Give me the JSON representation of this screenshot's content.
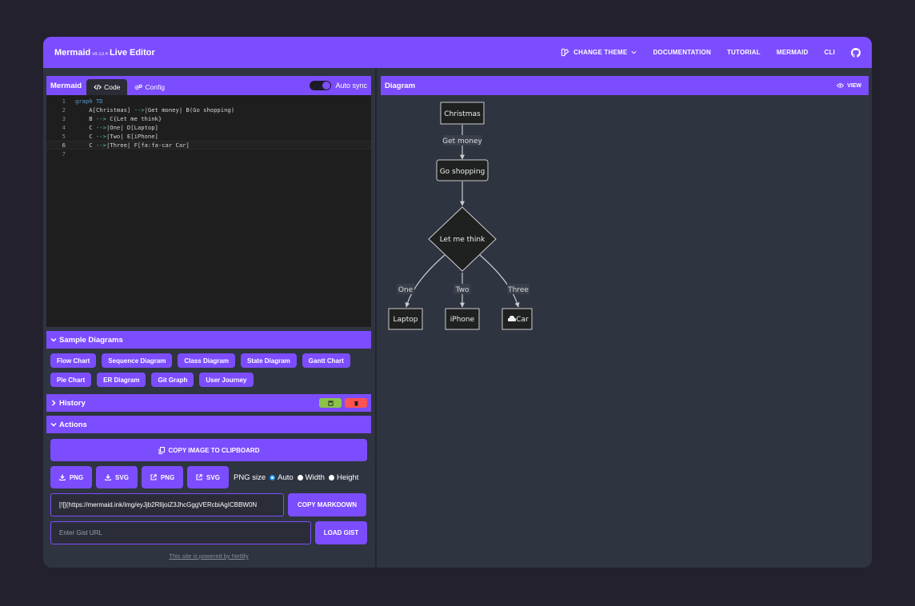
{
  "topbar": {
    "brand_name": "Mermaid",
    "brand_version": "v8.13.4",
    "brand_suffix": "Live Editor",
    "nav": [
      {
        "label": "CHANGE THEME",
        "icon": "palette-icon"
      },
      {
        "label": "DOCUMENTATION"
      },
      {
        "label": "TUTORIAL"
      },
      {
        "label": "MERMAID"
      },
      {
        "label": "CLI"
      }
    ],
    "github_icon": "github-icon"
  },
  "editor": {
    "title": "Mermaid",
    "tab_code": "Code",
    "tab_config": "Config",
    "auto_sync_label": "Auto sync",
    "auto_sync_on": true,
    "lines": [
      {
        "n": "1",
        "text": "graph TD"
      },
      {
        "n": "2",
        "text": "    A[Christmas] -->|Get money| B(Go shopping)"
      },
      {
        "n": "3",
        "text": "    B --> C{Let me think}"
      },
      {
        "n": "4",
        "text": "    C -->|One| D[Laptop]"
      },
      {
        "n": "5",
        "text": "    C -->|Two| E[iPhone]"
      },
      {
        "n": "6",
        "text": "    C -->|Three| F[fa:fa-car Car]"
      },
      {
        "n": "7",
        "text": ""
      }
    ],
    "current_line": 6
  },
  "samples": {
    "title": "Sample Diagrams",
    "buttons": [
      "Flow Chart",
      "Sequence Diagram",
      "Class Diagram",
      "State Diagram",
      "Gantt Chart",
      "Pie Chart",
      "ER Diagram",
      "Git Graph",
      "User Journey"
    ]
  },
  "history": {
    "title": "History",
    "save_color": "#8bc34a",
    "delete_color": "#ff5252"
  },
  "actions": {
    "title": "Actions",
    "copy_image_label": "COPY IMAGE TO CLIPBOARD",
    "export_buttons": [
      {
        "label": "PNG",
        "icon": "download-icon"
      },
      {
        "label": "SVG",
        "icon": "download-icon"
      },
      {
        "label": "PNG",
        "icon": "external-link-icon"
      },
      {
        "label": "SVG",
        "icon": "external-link-icon"
      }
    ],
    "png_size_label": "PNG size",
    "size_options": [
      {
        "label": "Auto",
        "selected": true
      },
      {
        "label": "Width",
        "selected": false
      },
      {
        "label": "Height",
        "selected": false
      }
    ],
    "markdown_value": "[![](https://mermaid.ink/img/eyJjb2RlIjoiZ3JhcGggVERcbiAgICBBW0N",
    "copy_markdown_label": "COPY MARKDOWN",
    "gist_placeholder": "Enter Gist URL",
    "load_gist_label": "LOAD GIST",
    "footer": "This site is powered by Netlify"
  },
  "diagram": {
    "title": "Diagram",
    "view_label": "VIEW",
    "nodes": {
      "christmas": "Christmas",
      "shopping": "Go shopping",
      "think": "Let me think",
      "laptop": "Laptop",
      "iphone": "iPhone",
      "car": "Car"
    },
    "edge_labels": {
      "money": "Get money",
      "one": "One",
      "two": "Two",
      "three": "Three"
    }
  },
  "colors": {
    "accent": "#7c4dff",
    "background": "#23212e",
    "panel": "#2f3441",
    "editor_bg": "#1e1e1e",
    "node_fill": "#1f2020",
    "node_stroke": "#cccccc"
  }
}
